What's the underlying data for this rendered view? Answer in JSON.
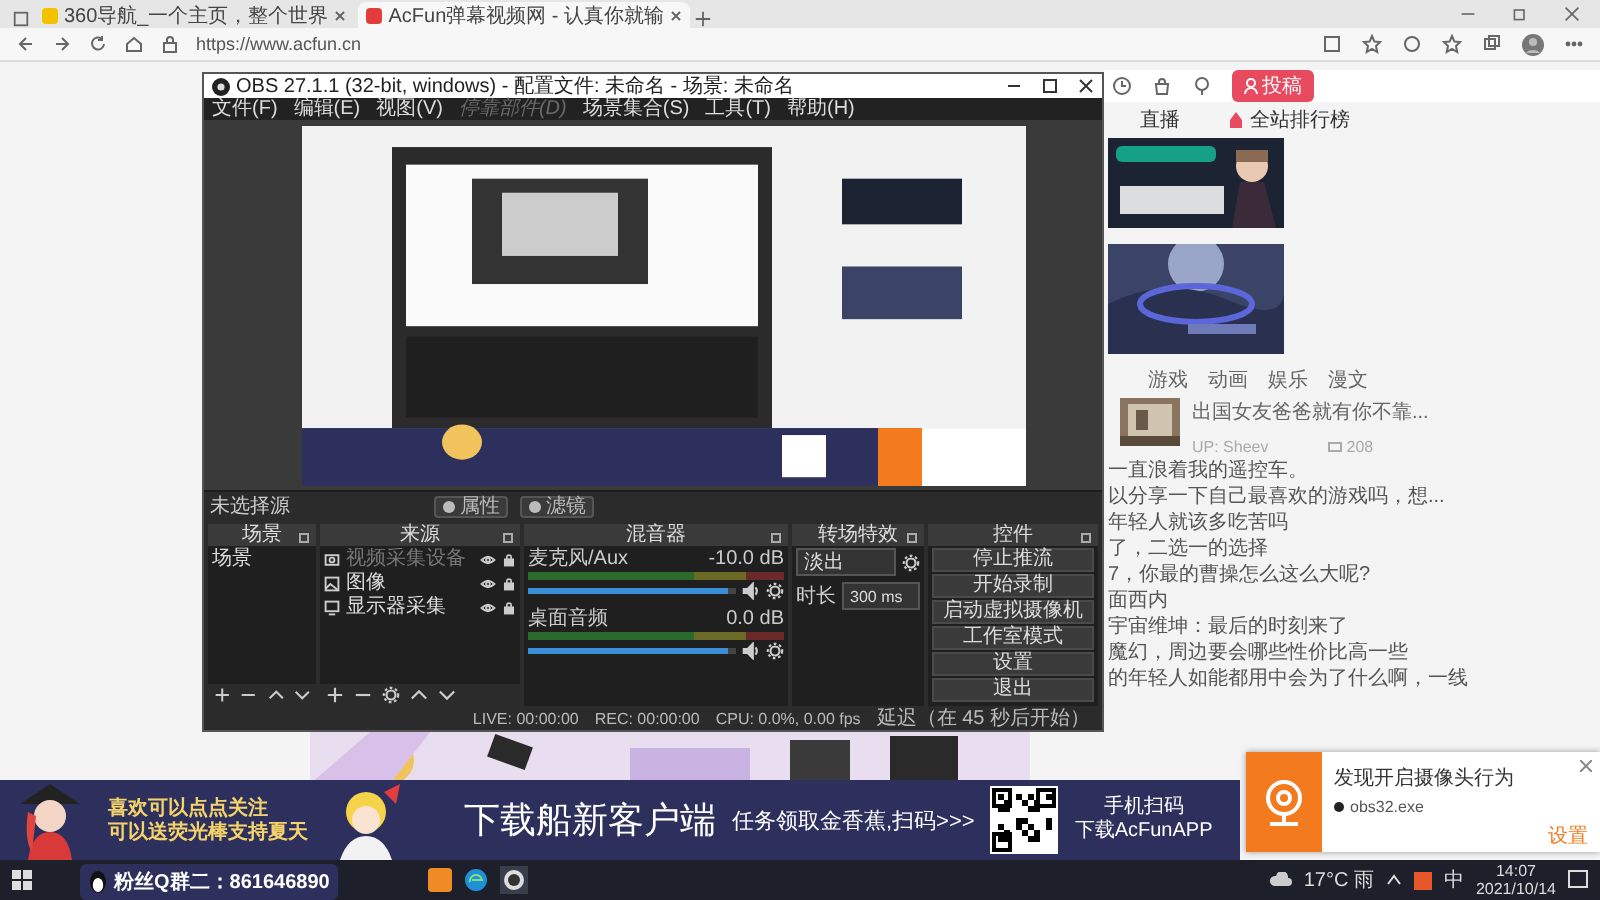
{
  "browser": {
    "tabs": [
      {
        "title": "360导航_一个主页，整个世界",
        "selected": false
      },
      {
        "title": "AcFun弹幕视频网 - 认真你就输",
        "selected": true
      }
    ],
    "url": "https://www.acfun.cn"
  },
  "page": {
    "upload_button": "投稿",
    "nav": [
      "直播",
      "全站排行榜"
    ],
    "tabs": [
      {
        "label": "游戏",
        "selected": false
      },
      {
        "label": "动画",
        "selected": false
      },
      {
        "label": "娱乐",
        "selected": false
      },
      {
        "label": "漫文",
        "selected": false
      }
    ],
    "feature": {
      "title": "出国女友爸爸就有你不靠...",
      "up": "UP: Sheev",
      "comments": "208"
    },
    "list": [
      "一直浪着我的遥控车。",
      "以分享一下自己最喜欢的游戏吗，想...",
      "年轻人就该多吃苦吗",
      "了，二选一的选择",
      "7，你最的曹操怎么这么大呢?",
      "面西内",
      "宇宙维坤：最后的时刻来了",
      "魔幻，周边要会哪些性价比高一些",
      "的年轻人如能都用中会为了什么啊，一线"
    ]
  },
  "obs": {
    "title": "OBS 27.1.1 (32-bit, windows) - 配置文件: 未命名 - 场景: 未命名",
    "menu": [
      {
        "label": "文件(F)",
        "disabled": false
      },
      {
        "label": "编辑(E)",
        "disabled": false
      },
      {
        "label": "视图(V)",
        "disabled": false
      },
      {
        "label": "停靠部件(D)",
        "disabled": true
      },
      {
        "label": "场景集合(S)",
        "disabled": false
      },
      {
        "label": "工具(T)",
        "disabled": false
      },
      {
        "label": "帮助(H)",
        "disabled": false
      }
    ],
    "source_bar": {
      "label": "未选择源",
      "buttons": [
        "属性",
        "滤镜"
      ]
    },
    "docks": {
      "scenes": {
        "title": "场景",
        "items": [
          "场景"
        ]
      },
      "sources": {
        "title": "来源",
        "items": [
          {
            "name": "视频采集设备",
            "disabled": true
          },
          {
            "name": "图像",
            "disabled": false
          },
          {
            "name": "显示器采集",
            "disabled": false
          }
        ]
      },
      "mixer": {
        "title": "混音器",
        "channels": [
          {
            "name": "麦克风/Aux",
            "reading": "-10.0 dB",
            "level": 0.96
          },
          {
            "name": "桌面音频",
            "reading": "0.0 dB",
            "level": 0.96
          }
        ]
      },
      "transitions": {
        "title": "转场特效",
        "transition": "淡出",
        "duration_label": "时长",
        "duration": "300 ms"
      },
      "controls": {
        "title": "控件",
        "buttons": [
          "停止推流",
          "开始录制",
          "启动虚拟摄像机",
          "工作室模式",
          "设置",
          "退出"
        ]
      }
    },
    "status": [
      "LIVE: 00:00:00",
      "REC: 00:00:00",
      "CPU: 0.0%, 0.00 fps",
      "延迟（在 45 秒后开始）"
    ]
  },
  "overlay": {
    "follow": [
      "喜欢可以点点关注",
      "可以送荧光棒支持夏天"
    ],
    "group": "粉丝Q群二：861646890",
    "headline": "下载船新客户端",
    "task": "任务领取金香蕉,扫码>>>",
    "scan": [
      "手机扫码",
      "下载AcFunAPP"
    ]
  },
  "notification": {
    "title": "发现开启摄像头行为",
    "process": "obs32.exe",
    "settings": "设置"
  },
  "taskbar": {
    "weather": "17°C 雨",
    "ime": "中",
    "time": "14:07",
    "date": "2021/10/14"
  }
}
